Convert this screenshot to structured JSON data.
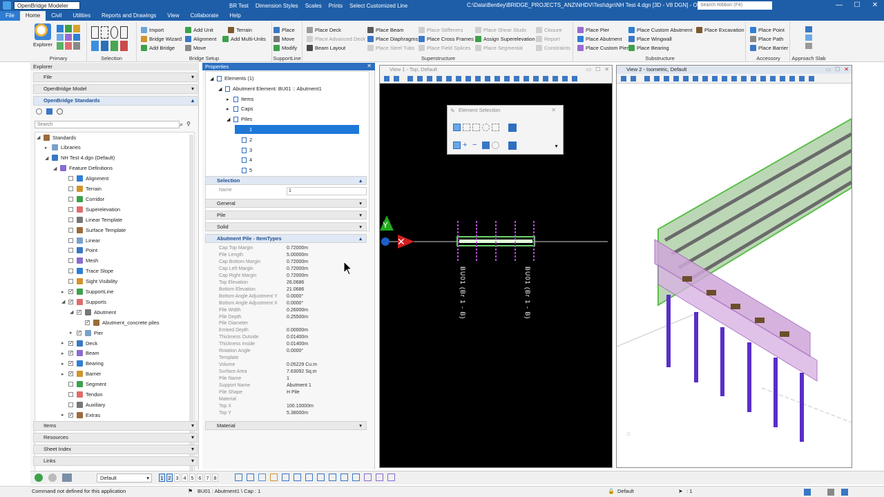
{
  "window": {
    "app_name": "OpenBridge Modeler",
    "quick_items": [
      "BR Test",
      "Dimension Styles",
      "Scales",
      "Prints",
      "Select Customized Line"
    ],
    "path": "C:\\Data\\Bentley\\BRIDGE_PROJECTS_ANZ\\NHDV\\Test\\dgn\\NH Test 4.dgn [3D - V8 DGN] - OpenBridge M",
    "search_placeholder": "Search Ribbon (F4)"
  },
  "tabs": [
    "File",
    "Home",
    "Civil",
    "Utilities",
    "Reports and Drawings",
    "View",
    "Collaborate",
    "Help"
  ],
  "ribbon": {
    "primary": {
      "label": "Primary",
      "explorer": "Explorer"
    },
    "selection": {
      "label": "Selection"
    },
    "bridge_setup": {
      "label": "Bridge Setup",
      "items": [
        "Import",
        "Add Unit",
        "Terrain",
        "Bridge Wizard",
        "Alignment",
        "Add Multi-Units",
        "Add Bridge",
        "Move"
      ]
    },
    "supportline": {
      "label": "SupportLine",
      "items": [
        "Place",
        "Move",
        "Modify"
      ]
    },
    "superstructure": {
      "label": "Superstructure",
      "items": [
        "Place Deck",
        "Place Advanced Deck",
        "Beam Layout",
        "Place Beam",
        "Place Diaphragms",
        "Place Steel Tubs",
        "Place Stiffeners",
        "Place Cross Frames",
        "Place Field Splices",
        "Place Shear Studs",
        "Assign Superelevation",
        "Place Segmental",
        "Closure",
        "Report",
        "Constraints"
      ]
    },
    "substructure": {
      "label": "Substructure",
      "items": [
        "Place Pier",
        "Place Abutment",
        "Place Custom Pier",
        "Place Custom Abutment",
        "Place Wingwall",
        "Place Bearing",
        "Place Excavation"
      ]
    },
    "accessory": {
      "label": "Accessory",
      "items": [
        "Place Point",
        "Place Path",
        "Place Barrier"
      ]
    },
    "approach": {
      "label": "Approach Slab"
    }
  },
  "explorer": {
    "title": "Explorer",
    "sections_top": [
      "File",
      "OpenBridge Model",
      "OpenBridge Standards"
    ],
    "search_placeholder": "Search",
    "tree": [
      {
        "label": "Standards",
        "indent": 0,
        "exp": "◢"
      },
      {
        "label": "Libraries",
        "indent": 1,
        "exp": "▸"
      },
      {
        "label": "NH Test 4.dgn (Default)",
        "indent": 1,
        "exp": "◢"
      },
      {
        "label": "Feature Definitions",
        "indent": 2,
        "exp": "◢"
      },
      {
        "label": "Alignment",
        "indent": 3
      },
      {
        "label": "Terrain",
        "indent": 3
      },
      {
        "label": "Corridor",
        "indent": 3
      },
      {
        "label": "Superelevation",
        "indent": 3
      },
      {
        "label": "Linear Template",
        "indent": 3
      },
      {
        "label": "Surface Template",
        "indent": 3
      },
      {
        "label": "Linear",
        "indent": 3
      },
      {
        "label": "Point",
        "indent": 3
      },
      {
        "label": "Mesh",
        "indent": 3
      },
      {
        "label": "Trace Slope",
        "indent": 3
      },
      {
        "label": "Sight Visibility",
        "indent": 3
      },
      {
        "label": "SupportLine",
        "indent": 3,
        "exp": "▸",
        "checked": true
      },
      {
        "label": "Supports",
        "indent": 3,
        "exp": "◢",
        "checked": true
      },
      {
        "label": "Abutment",
        "indent": 4,
        "exp": "◢",
        "checked": true
      },
      {
        "label": "Abutment_concrete piles",
        "indent": 5,
        "checked": true
      },
      {
        "label": "Pier",
        "indent": 4,
        "exp": "▸",
        "checked": true
      },
      {
        "label": "Deck",
        "indent": 3,
        "exp": "▸",
        "checked": true
      },
      {
        "label": "Beam",
        "indent": 3,
        "exp": "▸",
        "checked": true
      },
      {
        "label": "Bearing",
        "indent": 3,
        "exp": "▸",
        "checked": true
      },
      {
        "label": "Barrier",
        "indent": 3,
        "exp": "▸",
        "checked": true
      },
      {
        "label": "Segment",
        "indent": 3
      },
      {
        "label": "Tendon",
        "indent": 3
      },
      {
        "label": "Auxiliary",
        "indent": 3
      },
      {
        "label": "Extras",
        "indent": 3,
        "exp": "▸",
        "checked": true
      }
    ],
    "sections_bottom": [
      "Items",
      "Resources",
      "Sheet Index",
      "Links"
    ]
  },
  "properties": {
    "title": "Properties",
    "tree": [
      {
        "label": "Elements (1)",
        "indent": 0,
        "exp": "◢"
      },
      {
        "label": "Abutment Element: BU01 :: Abutment1",
        "indent": 1,
        "exp": "◢"
      },
      {
        "label": "Items",
        "indent": 2,
        "exp": "▸"
      },
      {
        "label": "Caps",
        "indent": 2,
        "exp": "▸"
      },
      {
        "label": "Piles",
        "indent": 2,
        "exp": "◢"
      },
      {
        "label": "1",
        "indent": 3,
        "selected": true
      },
      {
        "label": "2",
        "indent": 3
      },
      {
        "label": "3",
        "indent": 3
      },
      {
        "label": "4",
        "indent": 3
      },
      {
        "label": "5",
        "indent": 3
      }
    ],
    "selection_header": "Selection",
    "name_label": "Name",
    "name_value": "1",
    "collapsed": [
      "General",
      "Pile",
      "Solid"
    ],
    "itemtypes_header": "Abutment Pile - ItemTypes",
    "fields": [
      {
        "k": "Cap Top Margin",
        "v": "0.72000m"
      },
      {
        "k": "Pile Length",
        "v": "5.00000m"
      },
      {
        "k": "Cap Bottom Margin",
        "v": "0.72000m"
      },
      {
        "k": "Cap Left Margin",
        "v": "0.72000m"
      },
      {
        "k": "Cap Right Margin",
        "v": "0.72000m"
      },
      {
        "k": "Top Elevation",
        "v": "26.0686"
      },
      {
        "k": "Bottom Elevation",
        "v": "21.0686"
      },
      {
        "k": "Bottom Angle Adjustment Y",
        "v": "0.0000°"
      },
      {
        "k": "Bottom Angle Adjustment X",
        "v": "0.0000°"
      },
      {
        "k": "Pile Width",
        "v": "0.26000m"
      },
      {
        "k": "Pile Depth",
        "v": "0.25500m"
      },
      {
        "k": "Pile Diameter",
        "v": ""
      },
      {
        "k": "Embed Depth",
        "v": "0.00000m"
      },
      {
        "k": "Thickness Outside",
        "v": "0.01400m"
      },
      {
        "k": "Thickness Inside",
        "v": "0.01400m"
      },
      {
        "k": "Rotation Angle",
        "v": "0.0000°"
      },
      {
        "k": "Template",
        "v": ""
      },
      {
        "k": "Volume",
        "v": "0.05229 Cu.m"
      },
      {
        "k": "Surface Area",
        "v": "7.63092 Sq.m"
      },
      {
        "k": "Pile Name",
        "v": "1"
      },
      {
        "k": "Support Name",
        "v": "Abutment 1"
      },
      {
        "k": "Pile Shape",
        "v": "H Pile"
      },
      {
        "k": "Material",
        "v": ""
      },
      {
        "k": "Top X",
        "v": "100.10000m"
      },
      {
        "k": "Top Y",
        "v": "5.38000m"
      }
    ],
    "material_header": "Material"
  },
  "view1": {
    "title": "View 1 - Top, Default",
    "label_a": "BU01 (Br 1 - B)",
    "label_b": "BU01 (Br 1 - B)",
    "axis_y": "Y"
  },
  "view2": {
    "title": "View 2 - Isometric, Default"
  },
  "element_selection": {
    "title": "Element Selection"
  },
  "bottombar": {
    "level": "Default",
    "view_numbers": [
      "1",
      "2",
      "3",
      "4",
      "5",
      "6",
      "7",
      "8"
    ]
  },
  "status": {
    "message": "Command not defined for this application",
    "element": "BU01 : Abutment1 \\ Cap : 1",
    "level": "Default",
    "scale": ": 1"
  }
}
